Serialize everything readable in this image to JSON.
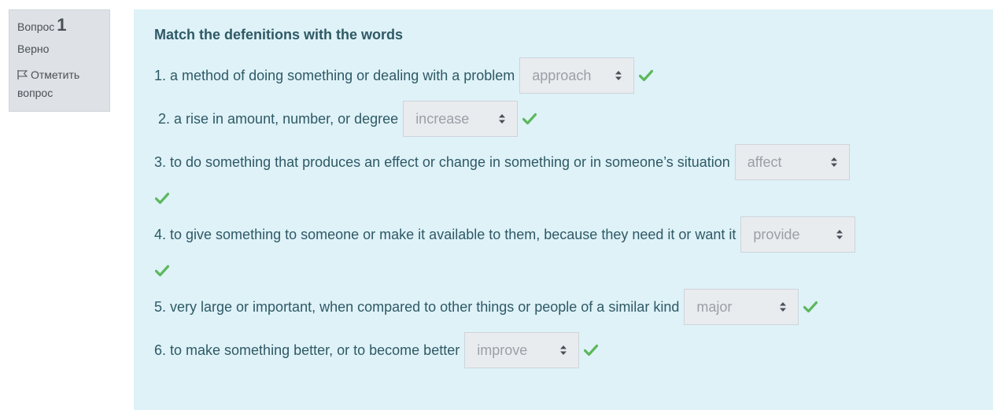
{
  "info": {
    "question_label": "Вопрос",
    "question_number": "1",
    "state": "Верно",
    "flag_label": "Отметить вопрос"
  },
  "question": {
    "title": "Match the defenitions with the words",
    "items": [
      {
        "text": "1. a method of doing something or dealing with a problem",
        "answer": "approach",
        "correct": true
      },
      {
        "text": " 2. a rise in amount, number, or degree",
        "answer": "increase",
        "correct": true
      },
      {
        "text": "3. to do something that produces an effect or change in something or in someone’s situation",
        "answer": "affect",
        "correct": true
      },
      {
        "text": "4. to give something to someone or make it available to them, because they need it or want it",
        "answer": "provide",
        "correct": true
      },
      {
        "text": "5. very large or important, when compared to other things or people of a similar kind",
        "answer": "major",
        "correct": true
      },
      {
        "text": "6. to make something better, or to become better",
        "answer": "improve",
        "correct": true
      }
    ]
  },
  "colors": {
    "panel_bg": "#def2f8",
    "text": "#2f5965",
    "check": "#5cb85c",
    "select_bg": "#e9ecef"
  },
  "icons": {
    "flag": "flag-icon",
    "check": "check-icon",
    "select_arrows": "select-arrows-icon"
  }
}
